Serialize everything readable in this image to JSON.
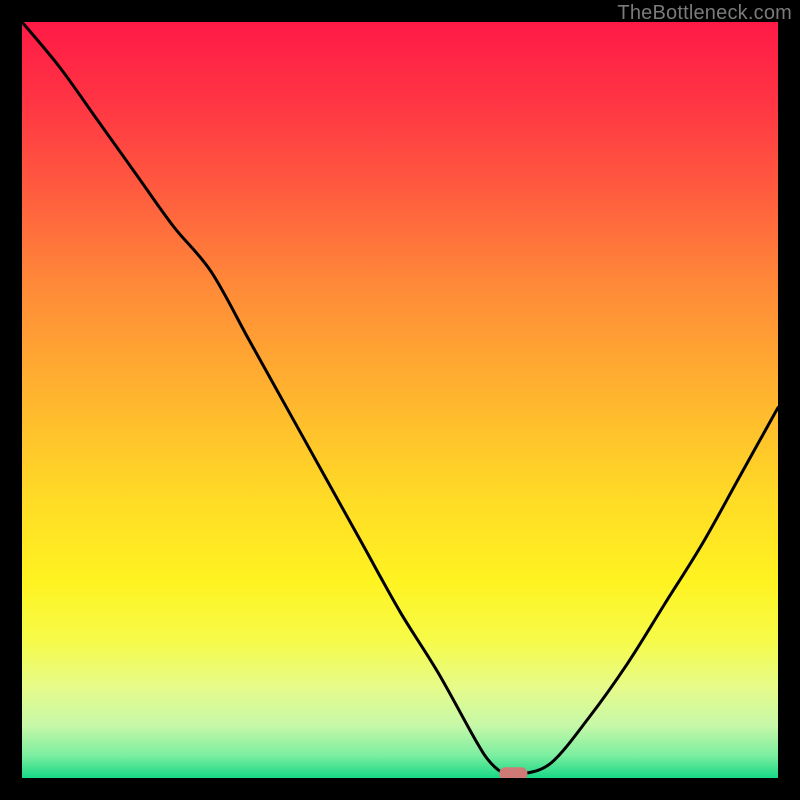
{
  "attribution": "TheBottleneck.com",
  "chart_data": {
    "type": "line",
    "title": "",
    "xlabel": "",
    "ylabel": "",
    "xlim": [
      0,
      100
    ],
    "ylim": [
      0,
      100
    ],
    "x": [
      0,
      5,
      10,
      15,
      20,
      25,
      30,
      35,
      40,
      45,
      50,
      55,
      60,
      62,
      64,
      66,
      70,
      75,
      80,
      85,
      90,
      95,
      100
    ],
    "values": [
      100,
      94,
      87,
      80,
      73,
      67,
      58,
      49,
      40,
      31,
      22,
      14,
      5,
      2,
      0.5,
      0.5,
      2,
      8,
      15,
      23,
      31,
      40,
      49
    ],
    "marker": {
      "x": 65,
      "y": 0.5
    },
    "background_gradient": {
      "type": "vertical",
      "stops": [
        {
          "pos": 0.0,
          "color": "#ff1a46"
        },
        {
          "pos": 0.1,
          "color": "#ff3344"
        },
        {
          "pos": 0.22,
          "color": "#ff5a3f"
        },
        {
          "pos": 0.35,
          "color": "#ff8a38"
        },
        {
          "pos": 0.5,
          "color": "#ffb62e"
        },
        {
          "pos": 0.63,
          "color": "#ffdb26"
        },
        {
          "pos": 0.74,
          "color": "#fff321"
        },
        {
          "pos": 0.82,
          "color": "#f6fb4a"
        },
        {
          "pos": 0.88,
          "color": "#e6fb8a"
        },
        {
          "pos": 0.93,
          "color": "#c7f8a8"
        },
        {
          "pos": 0.97,
          "color": "#7ceea0"
        },
        {
          "pos": 1.0,
          "color": "#17d885"
        }
      ]
    }
  }
}
